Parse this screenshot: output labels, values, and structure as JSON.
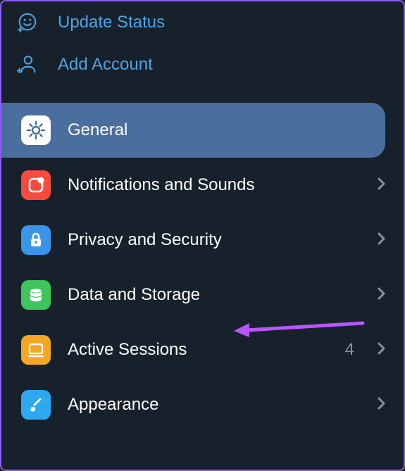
{
  "topLinks": {
    "updateStatus": "Update Status",
    "addAccount": "Add Account"
  },
  "settings": {
    "general": {
      "label": "General",
      "selected": true
    },
    "notifications": {
      "label": "Notifications and Sounds"
    },
    "privacy": {
      "label": "Privacy and Security"
    },
    "data": {
      "label": "Data and Storage"
    },
    "sessions": {
      "label": "Active Sessions",
      "badge": "4"
    },
    "appearance": {
      "label": "Appearance"
    }
  },
  "colors": {
    "accent": "#4fa3e3",
    "selected": "#4a6f9e",
    "general": "#ffffff",
    "notifications": "#f84b3e",
    "privacy": "#3a95e8",
    "data": "#3ec65c",
    "sessions": "#f5a623",
    "appearance": "#2ea8f0",
    "annotation": "#b855ff"
  }
}
